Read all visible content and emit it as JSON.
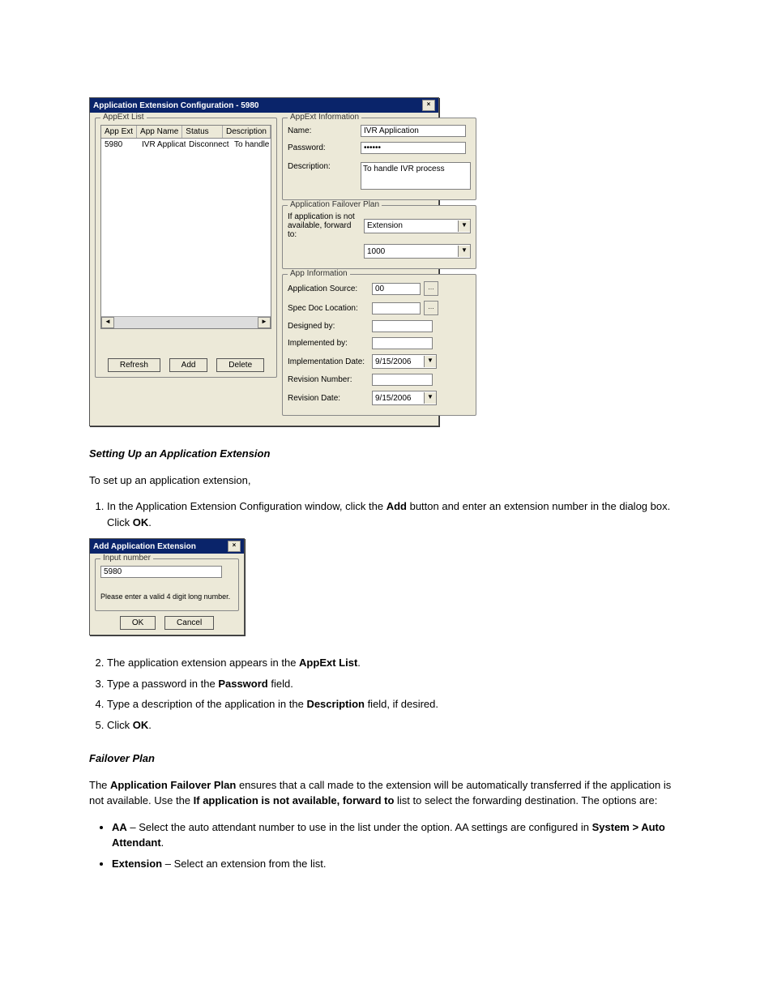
{
  "main_dialog": {
    "title": "Application Extension Configuration - 5980",
    "left": {
      "group": "AppExt List",
      "headers": [
        "App Ext",
        "App Name",
        "Status",
        "Description"
      ],
      "row": [
        "5980",
        "IVR Applicat...",
        "Disconnect",
        "To handle IVR process"
      ],
      "buttons": {
        "refresh": "Refresh",
        "add": "Add",
        "delete": "Delete"
      }
    },
    "right": {
      "info_group": "AppExt Information",
      "name_label": "Name:",
      "name_value": "IVR Application",
      "password_label": "Password:",
      "password_value": "••••••",
      "description_label": "Description:",
      "description_value": "To handle IVR process",
      "failover_group": "Application Failover Plan",
      "failover_text": "If application is not available, forward to:",
      "failover_combo1": "Extension",
      "failover_combo2": "1000",
      "appinfo_group": "App Information",
      "appsource_label": "Application Source:",
      "appsource_value": "00",
      "specdoc_label": "Spec Doc Location:",
      "designed_label": "Designed by:",
      "implemented_label": "Implemented by:",
      "impl_date_label": "Implementation Date:",
      "impl_date_value": "9/15/2006",
      "revnum_label": "Revision Number:",
      "revdate_label": "Revision Date:",
      "revdate_value": "9/15/2006"
    }
  },
  "add_dialog": {
    "title": "Add Application Extension",
    "group": "Input number",
    "value": "5980",
    "hint": "Please enter a valid 4 digit long number.",
    "ok": "OK",
    "cancel": "Cancel"
  },
  "prose": {
    "h_setup": "Setting Up an Application Extension",
    "p0": "To set up an application extension,",
    "s1a": "In the Application Extension Configuration window, click the ",
    "s1b_bold": "Add",
    "s1c": " button and enter an extension number in the dialog box. Click ",
    "s1d_bold": "OK",
    "s1e": ".",
    "s2a": "The application extension appears in the ",
    "s2b_bold": "AppExt List",
    "s2c": ".",
    "s3a": "Type a password in the ",
    "s3b_bold": "Password",
    "s3c": " field.",
    "s4a": "Type a description of the application in the ",
    "s4b_bold": "Description",
    "s4c": " field, if desired.",
    "s5a": "Click ",
    "s5b_bold": "OK",
    "s5c": ".",
    "h_failover": "Failover Plan",
    "f1a": "The ",
    "f1b_bold": "Application Failover Plan",
    "f1c": " ensures that a call made to the extension will be automatically transferred if the application is not available. Use the ",
    "f1d_bold": "If application is not available, forward to",
    "f1e": " list to select the forwarding destination. The options are:",
    "b1a_bold": "AA",
    "b1a": " – Select the auto attendant number to use in the list under the option. AA settings are configured in ",
    "b1b_bold": "System > Auto Attendant",
    "b1c": ".",
    "b2a_bold": "Extension",
    "b2a": " – Select an extension from the list."
  }
}
